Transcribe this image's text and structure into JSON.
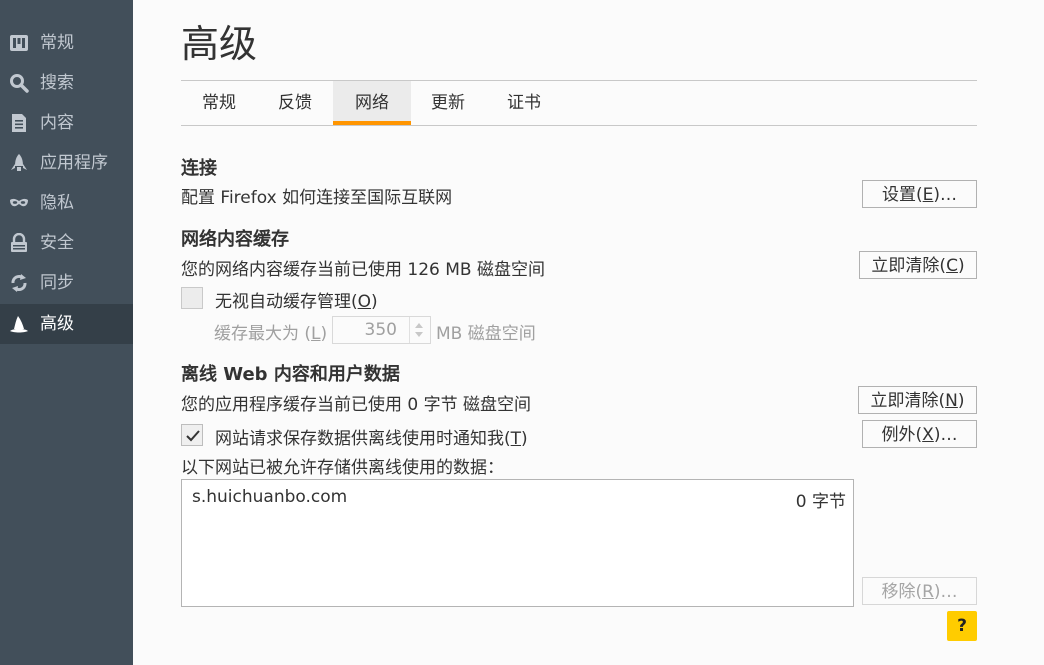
{
  "sidebar": {
    "items": [
      {
        "label": "常规",
        "icon": "general-icon"
      },
      {
        "label": "搜索",
        "icon": "search-icon"
      },
      {
        "label": "内容",
        "icon": "document-icon"
      },
      {
        "label": "应用程序",
        "icon": "rocket-icon"
      },
      {
        "label": "隐私",
        "icon": "mask-icon"
      },
      {
        "label": "安全",
        "icon": "lock-icon"
      },
      {
        "label": "同步",
        "icon": "sync-icon"
      },
      {
        "label": "高级",
        "icon": "wizard-hat-icon",
        "active": true
      }
    ]
  },
  "page": {
    "title": "高级"
  },
  "tabs": [
    {
      "label": "常规"
    },
    {
      "label": "反馈"
    },
    {
      "label": "网络",
      "active": true
    },
    {
      "label": "更新"
    },
    {
      "label": "证书"
    }
  ],
  "connection": {
    "heading": "连接",
    "description": "配置 Firefox 如何连接至国际互联网",
    "settings_button": {
      "text": "设置(",
      "key": "E",
      "suffix": ")…"
    }
  },
  "cache": {
    "heading": "网络内容缓存",
    "status": "您的网络内容缓存当前已使用 126 MB 磁盘空间",
    "clear_button": {
      "text": "立即清除(",
      "key": "C",
      "suffix": ")"
    },
    "override": {
      "text": "无视自动缓存管理(",
      "key": "O",
      "suffix": ")",
      "checked": false
    },
    "limit_label": {
      "text": "缓存最大为 (",
      "key": "L",
      "suffix": ")"
    },
    "limit_value": "350",
    "limit_unit": "MB 磁盘空间"
  },
  "offline": {
    "heading": "离线 Web 内容和用户数据",
    "status": "您的应用程序缓存当前已使用 0 字节 磁盘空间",
    "clear_button": {
      "text": "立即清除(",
      "key": "N",
      "suffix": ")"
    },
    "notify": {
      "text": "网站请求保存数据供离线使用时通知我(",
      "key": "T",
      "suffix": ")",
      "checked": true
    },
    "exceptions_button": {
      "text": "例外(",
      "key": "X",
      "suffix": ")…"
    },
    "list_label": "以下网站已被允许存储供离线使用的数据：",
    "sites": [
      {
        "site": "s.huichuanbo.com",
        "size": "0 字节"
      }
    ],
    "remove_button": {
      "text": "移除(",
      "key": "R",
      "suffix": ")…"
    }
  },
  "help": {
    "label": "?"
  },
  "colors": {
    "sidebar": "#424f5a",
    "sidebar_active": "#343f48",
    "tab_accent": "#ff9500",
    "help": "#ffcc00"
  }
}
